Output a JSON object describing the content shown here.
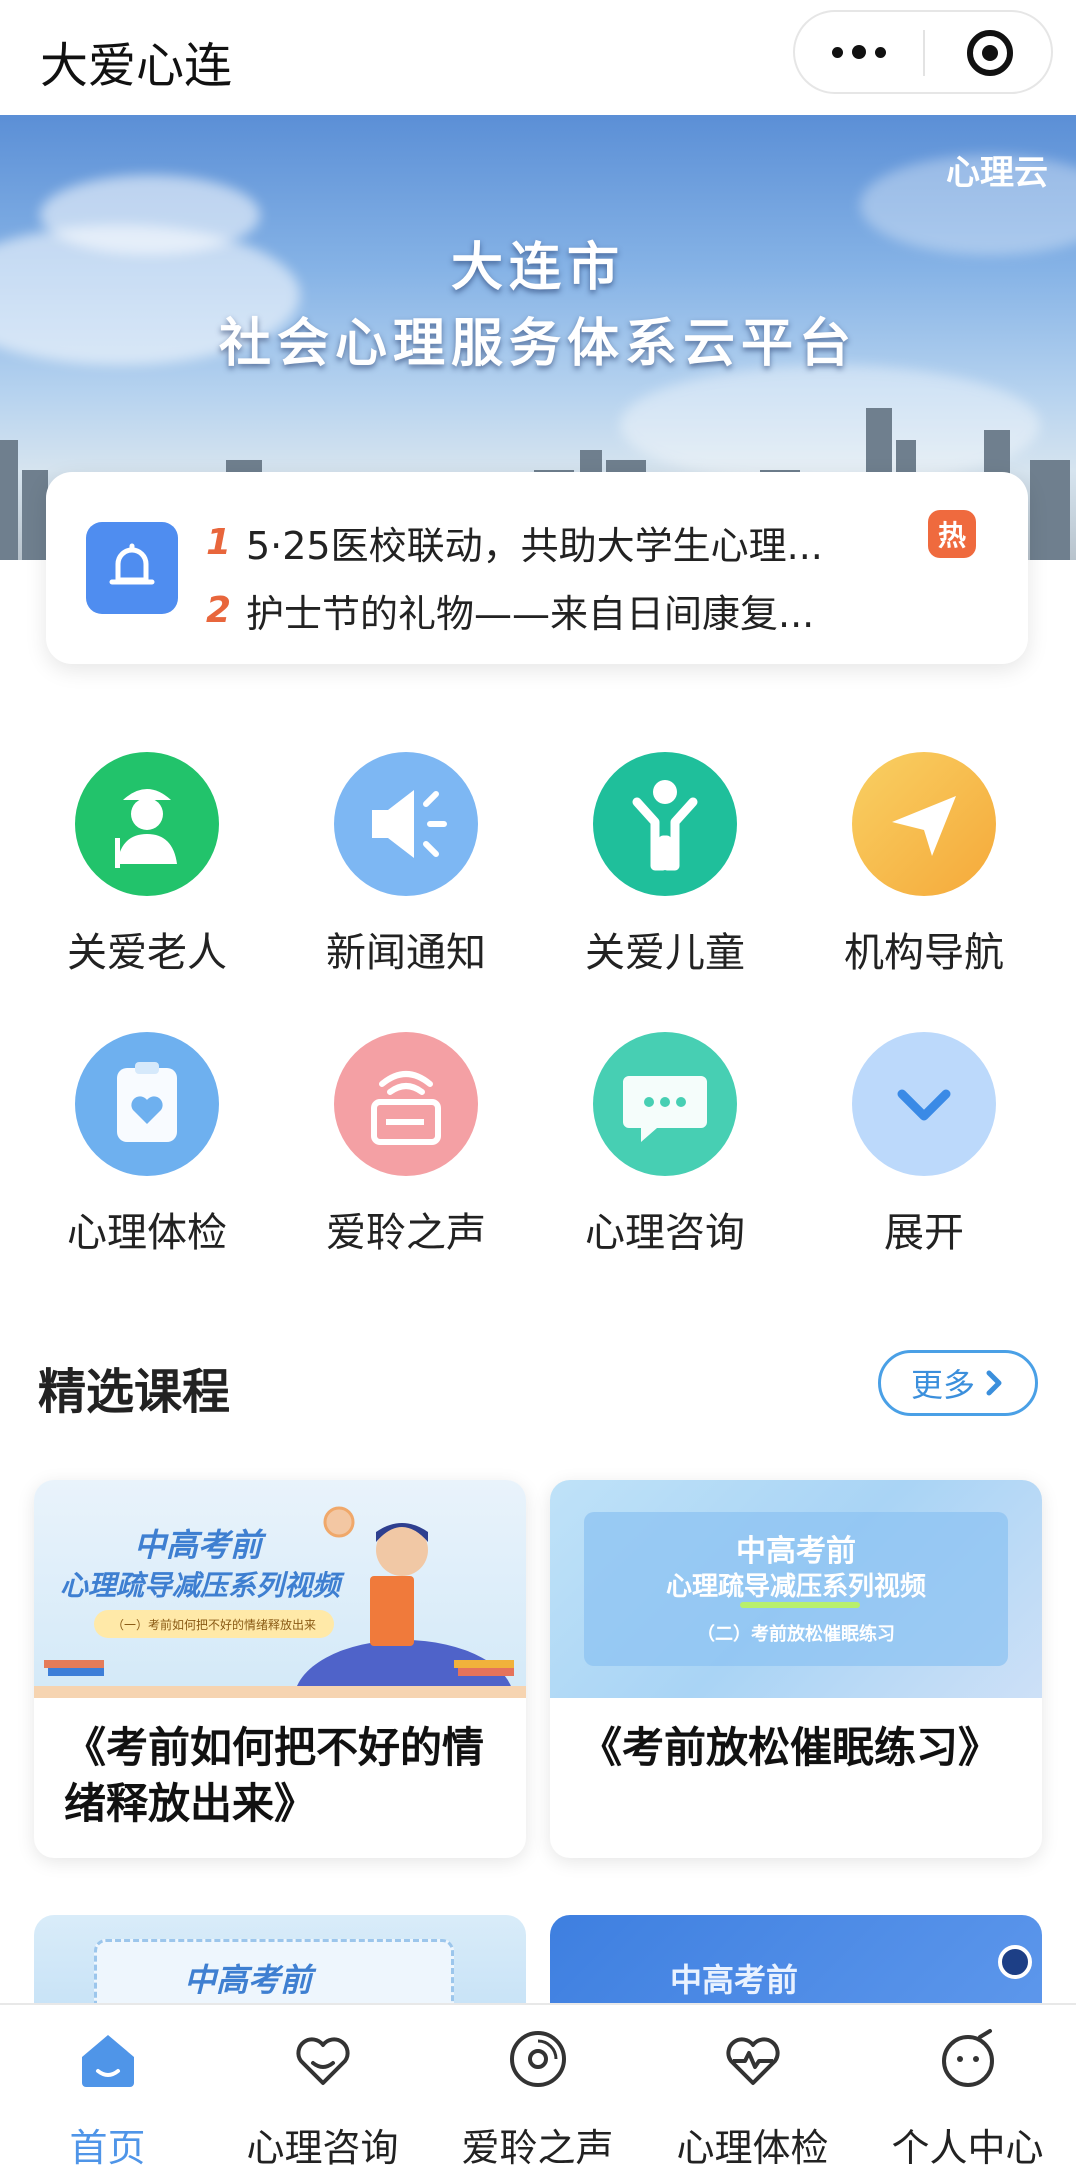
{
  "app": {
    "title": "大爱心连"
  },
  "banner": {
    "brand": "心理云",
    "title_line1": "大连市",
    "title_line2": "社会心理服务体系云平台"
  },
  "notices": [
    {
      "index": "1",
      "text": "5·25医校联动，共助大学生心理...",
      "badge": "热"
    },
    {
      "index": "2",
      "text": "护士节的礼物——来自日间康复..."
    }
  ],
  "entries": [
    {
      "label": "关爱老人",
      "icon": "elderly-icon",
      "color": "#22c36b"
    },
    {
      "label": "新闻通知",
      "icon": "megaphone-icon",
      "color": "#7db7f3"
    },
    {
      "label": "关爱儿童",
      "icon": "child-icon",
      "color": "#1fbf9b"
    },
    {
      "label": "机构导航",
      "icon": "navigation-icon",
      "color": "#f6b949"
    },
    {
      "label": "心理体检",
      "icon": "checkup-icon",
      "color": "#6eb0ef"
    },
    {
      "label": "爱聆之声",
      "icon": "radio-icon",
      "color": "#f4a0a4"
    },
    {
      "label": "心理咨询",
      "icon": "chat-icon",
      "color": "#47cfb3"
    },
    {
      "label": "展开",
      "icon": "chevron-down-icon",
      "color": "#bcd9fb"
    }
  ],
  "section": {
    "title": "精选课程",
    "more": "更多"
  },
  "courses": [
    {
      "title": "《考前如何把不好的情绪释放出来》",
      "thumb_line1": "中高考前",
      "thumb_line2": "心理疏导减压系列视频",
      "thumb_line3": "（一）考前如何把不好的情绪释放出来"
    },
    {
      "title": "《考前放松催眠练习》",
      "thumb_line1": "中高考前",
      "thumb_line2": "心理疏导减压系列视频",
      "thumb_line3": "（二）考前放松催眠练习"
    }
  ],
  "peeks": [
    {
      "text": "中高考前"
    },
    {
      "text": "中高考前"
    }
  ],
  "tabs": [
    {
      "label": "首页",
      "icon": "home-icon",
      "active": true
    },
    {
      "label": "心理咨询",
      "icon": "heart-icon"
    },
    {
      "label": "爱聆之声",
      "icon": "disc-icon"
    },
    {
      "label": "心理体检",
      "icon": "pulse-heart-icon"
    },
    {
      "label": "个人中心",
      "icon": "face-icon"
    }
  ],
  "colors": {
    "accent": "#4f95e8",
    "hot": "#ef6a3e",
    "notice_index": "#e8663c"
  }
}
